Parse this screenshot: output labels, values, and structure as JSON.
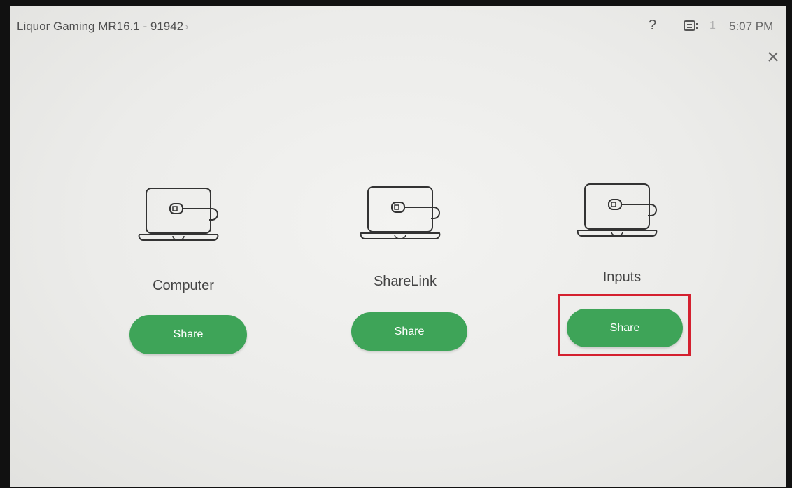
{
  "topbar": {
    "room_title": "Liquor Gaming MR16.1 - 91942",
    "title_chevron": "›",
    "help_label": "?",
    "participant_count": "1",
    "time": "5:07 PM",
    "icons": [
      "help-icon",
      "camera-icon",
      "close-icon"
    ]
  },
  "options": [
    {
      "label": "Computer",
      "button": "Share",
      "icon": "laptop-cable-icon"
    },
    {
      "label": "ShareLink",
      "button": "Share",
      "icon": "laptop-cable-icon"
    },
    {
      "label": "Inputs",
      "button": "Share",
      "icon": "laptop-cable-icon"
    }
  ],
  "colors": {
    "share_button": "#3ea458",
    "highlight": "#d4202f",
    "background": "#ececea"
  }
}
